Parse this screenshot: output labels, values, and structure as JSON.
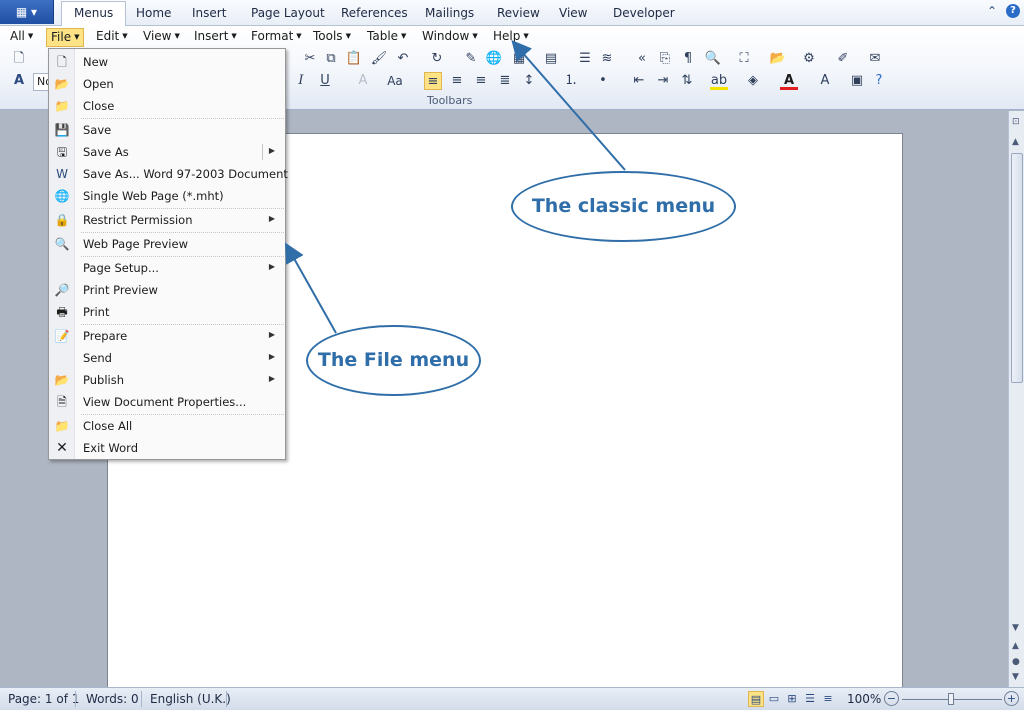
{
  "ribbon_tabs": {
    "menus": "Menus",
    "home": "Home",
    "insert": "Insert",
    "page_layout": "Page Layout",
    "references": "References",
    "mailings": "Mailings",
    "review": "Review",
    "view": "View",
    "developer": "Developer"
  },
  "window_controls": {
    "up": "⌃",
    "help": "?"
  },
  "classic_menubar": {
    "all": "All",
    "file": "File",
    "edit": "Edit",
    "view": "View",
    "insert": "Insert",
    "format": "Format",
    "tools": "Tools",
    "table": "Table",
    "window": "Window",
    "help": "Help"
  },
  "toolbar": {
    "group_label": "Toolbars",
    "style_box_text": "No"
  },
  "file_menu": {
    "new": "New",
    "open": "Open",
    "close": "Close",
    "save": "Save",
    "save_as": "Save As",
    "save_as_word97": "Save As... Word 97-2003 Document",
    "single_web_page": "Single Web Page (*.mht)",
    "restrict_permission": "Restrict Permission",
    "web_page_preview": "Web Page Preview",
    "page_setup": "Page Setup...",
    "print_preview": "Print Preview",
    "print": "Print",
    "prepare": "Prepare",
    "send": "Send",
    "publish": "Publish",
    "view_document_properties": "View Document Properties...",
    "close_all": "Close All",
    "exit_word": "Exit Word"
  },
  "callouts": {
    "classic_menu": "The classic menu",
    "file_menu": "The File menu"
  },
  "status_bar": {
    "page": "Page: 1 of 1",
    "words": "Words: 0",
    "language": "English (U.K.)",
    "zoom": "100%"
  },
  "colors": {
    "accent": "#2f6ea8",
    "highlight": "#fde386"
  }
}
